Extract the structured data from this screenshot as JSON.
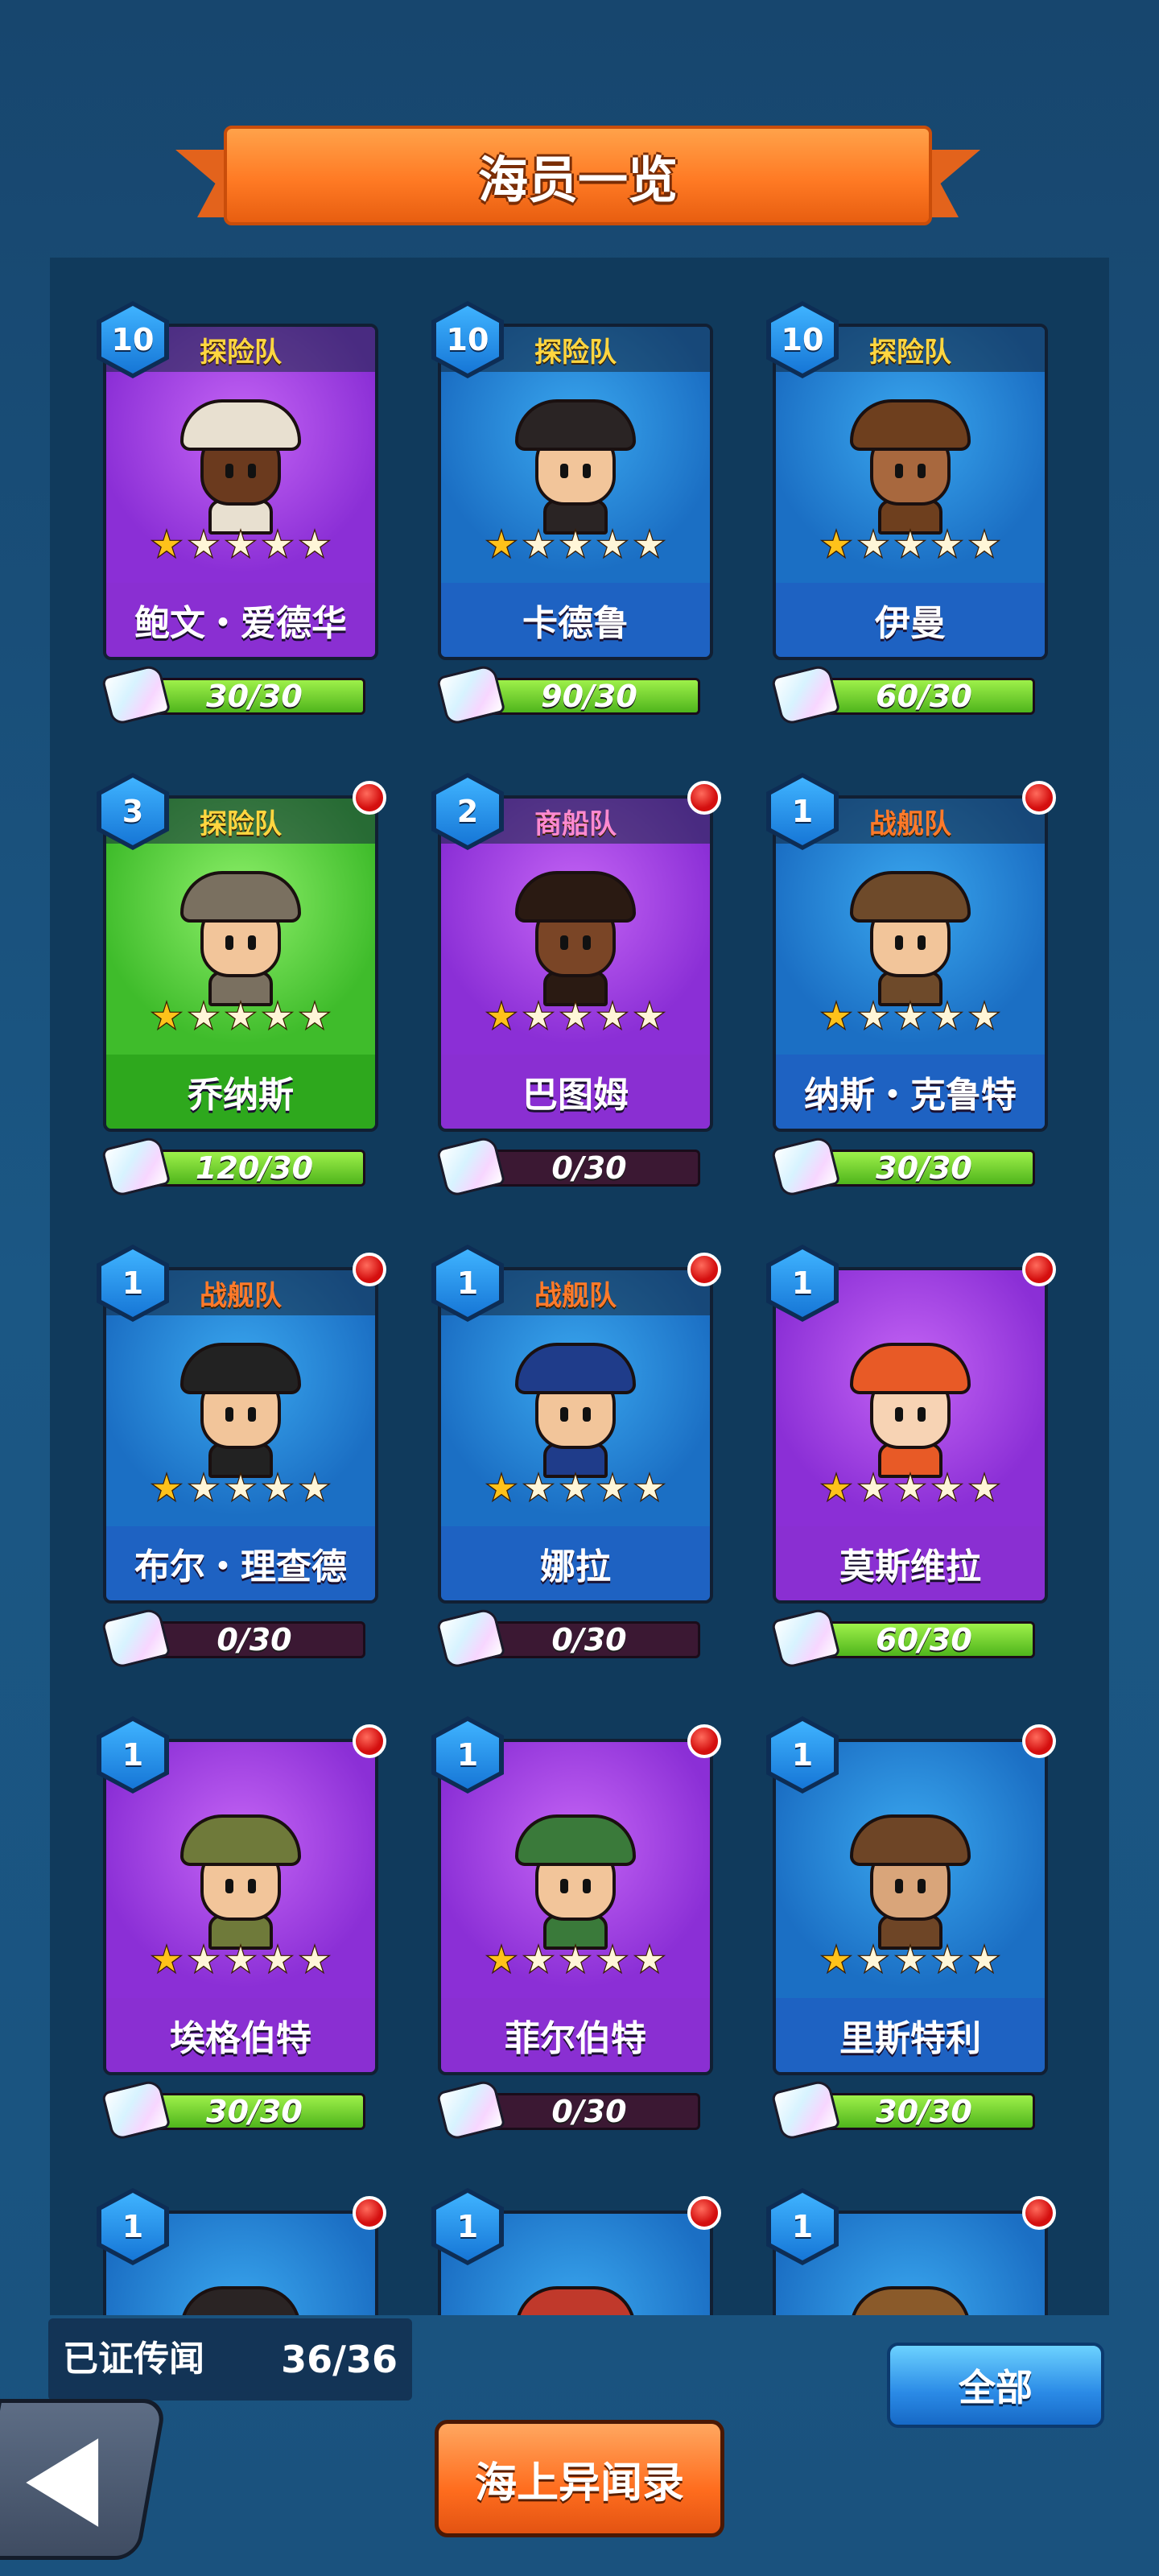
{
  "header": {
    "title": "海员一览"
  },
  "cards": [
    {
      "level": "10",
      "team": "探险队",
      "team_type": "explore",
      "name": "鲍文・爱德华",
      "progress": "30/30",
      "fill": 1.0,
      "theme": "purple",
      "dot": false,
      "stars": 1,
      "skin": "#6b3a1e",
      "hat": "#e8e0d0"
    },
    {
      "level": "10",
      "team": "探险队",
      "team_type": "explore",
      "name": "卡德鲁",
      "progress": "90/30",
      "fill": 1.0,
      "theme": "blue",
      "dot": false,
      "stars": 1,
      "skin": "#f2c59a",
      "hat": "#2a2424"
    },
    {
      "level": "10",
      "team": "探险队",
      "team_type": "explore",
      "name": "伊曼",
      "progress": "60/30",
      "fill": 1.0,
      "theme": "blue",
      "dot": false,
      "stars": 1,
      "skin": "#a8683e",
      "hat": "#6e3f1e"
    },
    {
      "level": "3",
      "team": "探险队",
      "team_type": "explore",
      "name": "乔纳斯",
      "progress": "120/30",
      "fill": 1.0,
      "theme": "green",
      "dot": true,
      "stars": 1,
      "skin": "#f2c59a",
      "hat": "#7a7060"
    },
    {
      "level": "2",
      "team": "商船队",
      "team_type": "merchant",
      "name": "巴图姆",
      "progress": "0/30",
      "fill": 0.0,
      "theme": "purple",
      "dot": true,
      "stars": 1,
      "skin": "#7a4526",
      "hat": "#2a1a12"
    },
    {
      "level": "1",
      "team": "战舰队",
      "team_type": "war",
      "name": "纳斯・克鲁特",
      "progress": "30/30",
      "fill": 1.0,
      "theme": "blue",
      "dot": true,
      "stars": 1,
      "skin": "#f2c59a",
      "hat": "#6e4a2a"
    },
    {
      "level": "1",
      "team": "战舰队",
      "team_type": "war",
      "name": "布尔・理查德",
      "progress": "0/30",
      "fill": 0.0,
      "theme": "blue",
      "dot": true,
      "stars": 1,
      "skin": "#f2c59a",
      "hat": "#222222"
    },
    {
      "level": "1",
      "team": "战舰队",
      "team_type": "war",
      "name": "娜拉",
      "progress": "0/30",
      "fill": 0.0,
      "theme": "blue",
      "dot": true,
      "stars": 1,
      "skin": "#f2c59a",
      "hat": "#1f3c8a"
    },
    {
      "level": "1",
      "team": "",
      "team_type": "",
      "name": "莫斯维拉",
      "progress": "60/30",
      "fill": 1.0,
      "theme": "purple",
      "dot": true,
      "stars": 1,
      "skin": "#f7d3b4",
      "hat": "#e85a26"
    },
    {
      "level": "1",
      "team": "",
      "team_type": "",
      "name": "埃格伯特",
      "progress": "30/30",
      "fill": 1.0,
      "theme": "purple",
      "dot": true,
      "stars": 1,
      "skin": "#f2c59a",
      "hat": "#6f7a3a"
    },
    {
      "level": "1",
      "team": "",
      "team_type": "",
      "name": "菲尔伯特",
      "progress": "0/30",
      "fill": 0.0,
      "theme": "purple",
      "dot": true,
      "stars": 1,
      "skin": "#f2c59a",
      "hat": "#3a7a3a"
    },
    {
      "level": "1",
      "team": "",
      "team_type": "",
      "name": "里斯特利",
      "progress": "30/30",
      "fill": 1.0,
      "theme": "blue",
      "dot": true,
      "stars": 1,
      "skin": "#d9a57a",
      "hat": "#6e4526"
    },
    {
      "level": "1",
      "team": "",
      "team_type": "",
      "name": "",
      "progress": "",
      "fill": 0.0,
      "theme": "blue",
      "dot": true,
      "stars": 0,
      "skin": "#f2c59a",
      "hat": "#2a2424"
    },
    {
      "level": "1",
      "team": "",
      "team_type": "",
      "name": "",
      "progress": "",
      "fill": 0.0,
      "theme": "blue",
      "dot": true,
      "stars": 0,
      "skin": "#f2c59a",
      "hat": "#c0392b"
    },
    {
      "level": "1",
      "team": "",
      "team_type": "",
      "name": "",
      "progress": "",
      "fill": 0.0,
      "theme": "blue",
      "dot": true,
      "stars": 0,
      "skin": "#f2c59a",
      "hat": "#8a5a2a"
    }
  ],
  "footer": {
    "proven_label": "已证传闻",
    "proven_count": "36/36",
    "all_button": "全部",
    "log_button": "海上异闻录"
  }
}
